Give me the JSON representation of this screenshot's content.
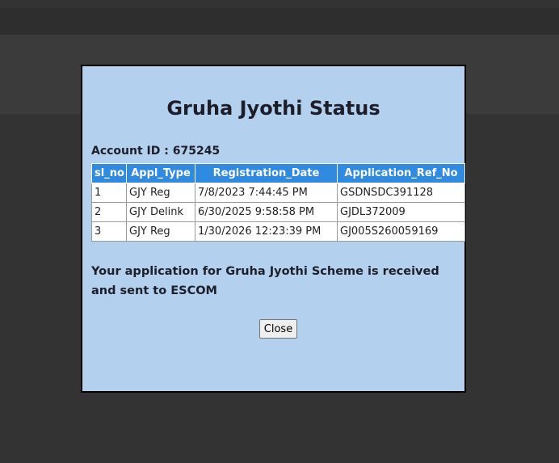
{
  "modal": {
    "title": "Gruha Jyothi Status",
    "account_label": "Account ID : 675245",
    "table": {
      "headers": [
        "sl_no",
        "Appl_Type",
        "Registration_Date",
        "Application_Ref_No"
      ],
      "rows": [
        [
          "1",
          "GJY Reg",
          "7/8/2023 7:44:45 PM",
          "GSDNSDC391128"
        ],
        [
          "2",
          "GJY Delink",
          "6/30/2025 9:58:58 PM",
          "GJDL372009"
        ],
        [
          "3",
          "GJY Reg",
          "1/30/2026 12:23:39 PM",
          "GJ005S260059169"
        ]
      ]
    },
    "message": "Your application for Gruha Jyothi Scheme is received and sent to ESCOM",
    "close_label": "Close"
  },
  "colors": {
    "modal_bg": "#b3d0ef",
    "header_bg": "#2f8ae0",
    "page_bg": "#363636"
  }
}
